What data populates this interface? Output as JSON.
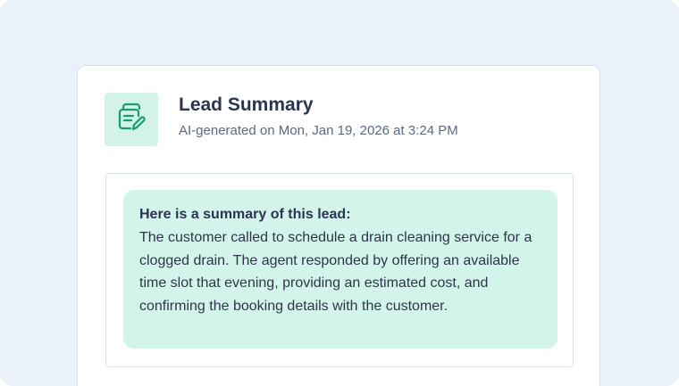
{
  "card": {
    "icon": "notes-edit-icon",
    "title": "Lead Summary",
    "subtitle": "AI-generated on Mon, Jan 19, 2026 at 3:24 PM"
  },
  "summary": {
    "heading": "Here is a summary of this lead:",
    "body": "The customer called to schedule a drain cleaning service for a clogged drain. The agent responded by offering an available time slot that evening, providing an estimated cost, and confirming the booking details with the customer."
  },
  "colors": {
    "page_background": "#eaf1f9",
    "icon_tile": "#d3f3e9",
    "icon_stroke": "#1a9c72",
    "summary_bubble": "#d3f4ea",
    "title_text": "#2a3550"
  }
}
